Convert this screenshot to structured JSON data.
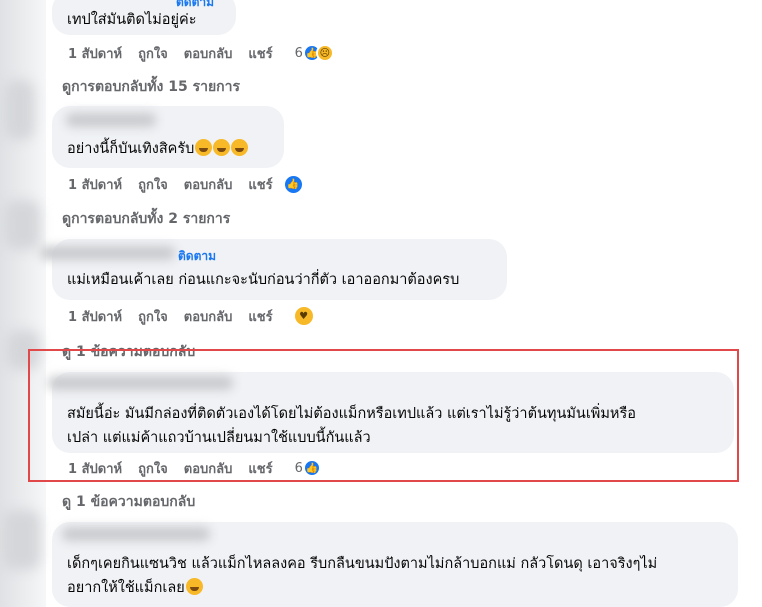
{
  "comments": [
    {
      "text": "เทปใส่มันติดไม่อยู่ค่ะ",
      "follow": "ติดตาม",
      "time": "1 สัปดาห์",
      "like": "ถูกใจ",
      "reply": "ตอบกลับ",
      "share": "แชร์",
      "reactions_count": "6",
      "reactions": [
        "like-icon",
        "sad-icon"
      ]
    },
    {
      "text": "อย่างนี้ก็บันเทิงสิครับ",
      "time": "1 สัปดาห์",
      "like": "ถูกใจ",
      "reply": "ตอบกลับ",
      "share": "แชร์",
      "reactions": [
        "like-icon"
      ]
    },
    {
      "follow": "ติดตาม",
      "text": "แม่เหมือนเค้าเลย ก่อนแกะจะนับก่อนว่ากี่ตัว เอาออกมาต้องครบ",
      "time": "1 สัปดาห์",
      "like": "ถูกใจ",
      "reply": "ตอบกลับ",
      "share": "แชร์",
      "reactions": [
        "care-icon"
      ]
    },
    {
      "text_line1": "สมัยนี้อ่ะ มันมีกล่องที่ติดตัวเองได้โดยไม่ต้องแม็กหรือเทปแล้ว แต่เราไม่รู้ว่าต้นทุนมันเพิ่มหรือ",
      "text_line2": "เปล่า แต่แม่ค้าแถวบ้านเปลี่ยนมาใช้แบบนี้กันแล้ว",
      "time": "1 สัปดาห์",
      "like": "ถูกใจ",
      "reply": "ตอบกลับ",
      "share": "แชร์",
      "reactions_count": "6",
      "reactions": [
        "like-icon"
      ]
    },
    {
      "text_line1": "เด็กๆเคยกินแซนวิช แล้วแม็กไหลลงคอ รีบกลืนขนมปังตามไม่กล้าบอกแม่ กลัวโดนดุ เอาจริงๆไม่",
      "text_line2": "อยากให้ใช้แม็กเลย"
    }
  ],
  "replies_links": [
    "ดูการตอบกลับทั้ง 15 รายการ",
    "ดูการตอบกลับทั้ง 2 รายการ",
    "ดู 1 ข้อความตอบกลับ",
    "ดู 1 ข้อความตอบกลับ"
  ],
  "colors": {
    "accent": "#1877f2",
    "highlight": "#e0484a",
    "bubble": "#f0f2f5",
    "meta": "#65676b"
  }
}
